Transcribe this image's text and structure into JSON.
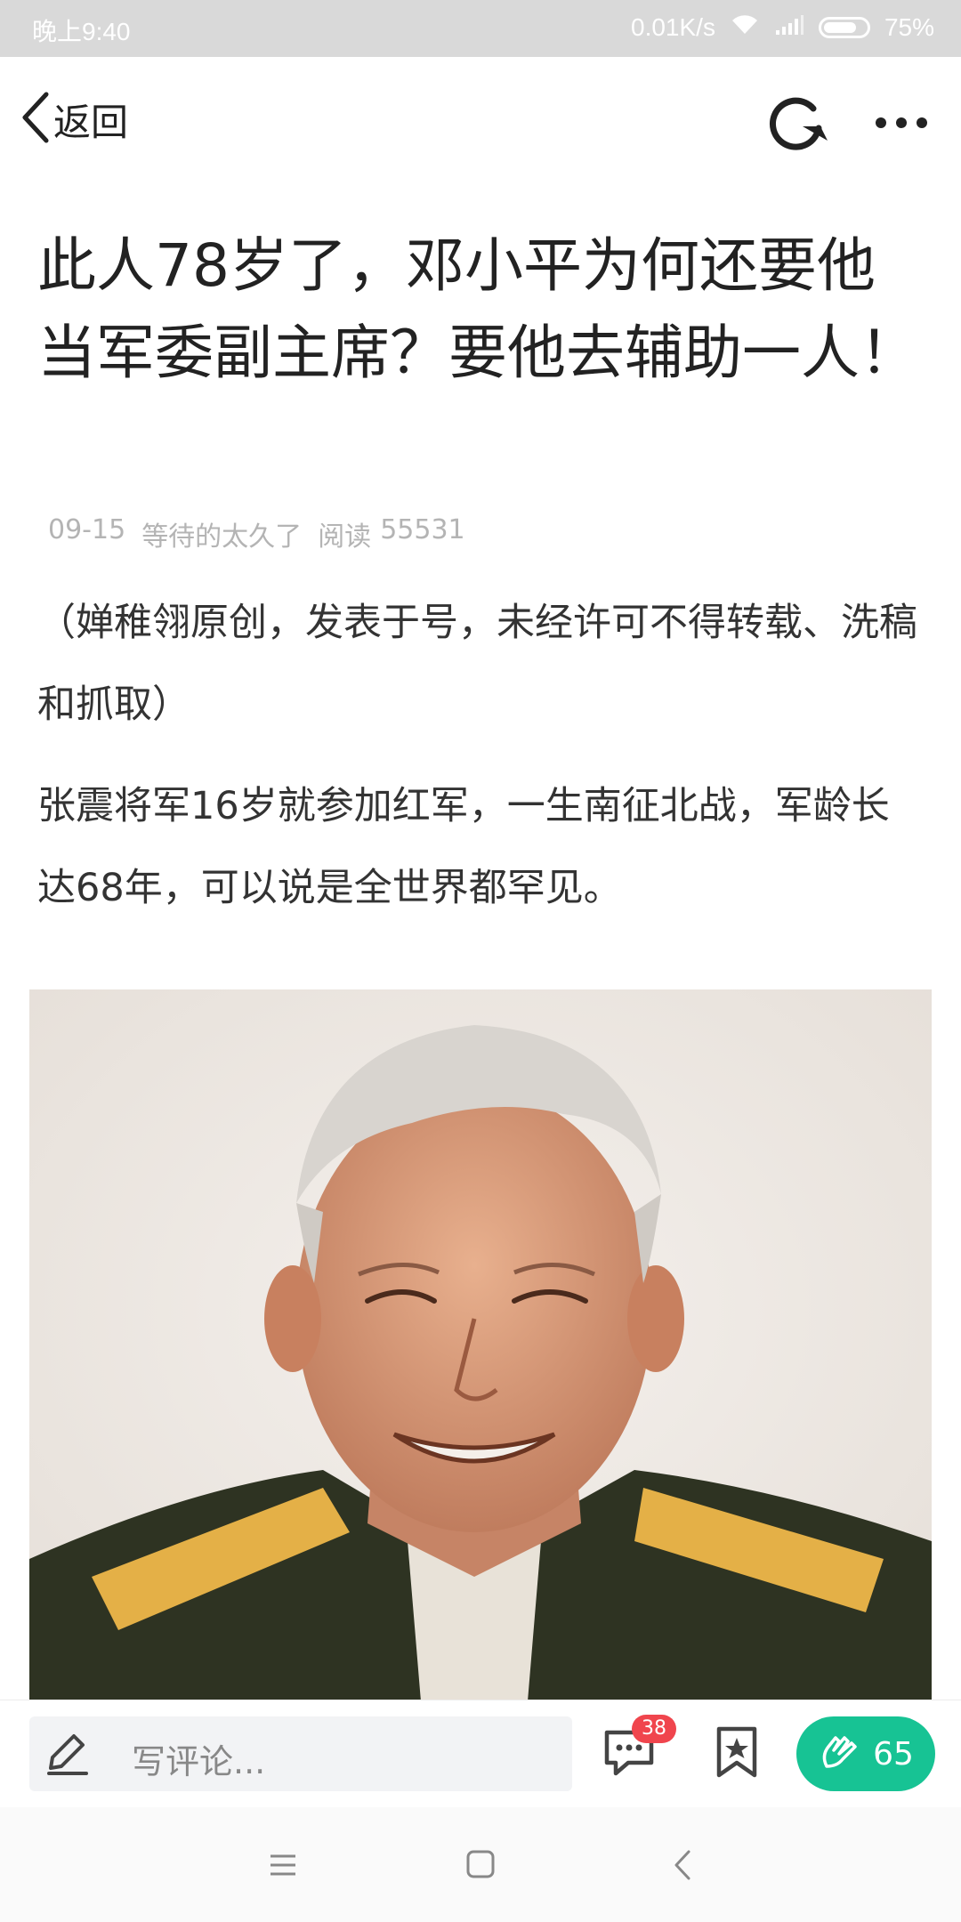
{
  "status_bar": {
    "time": "晚上9:40",
    "network_speed": "0.01K/s",
    "battery": "75%",
    "battery_level": 0.75
  },
  "nav": {
    "back_label": "返回",
    "refresh_icon": "refresh-icon",
    "more_icon": "more-icon"
  },
  "article": {
    "title": "此人78岁了，邓小平为何还要他当军委副主席？要他去辅助一人！",
    "date": "09-15",
    "author": "等待的太久了",
    "reads_label": "阅读",
    "reads_count": "55531",
    "paragraphs": [
      "（婵稚翎原创，发表于号，未经许可不得转载、洗稿和抓取）",
      "张震将军16岁就参加红军，一生南征北战，军龄长达68年，可以说是全世界都罕见。"
    ]
  },
  "action_bar": {
    "comment_placeholder": "写评论...",
    "comment_count": "38",
    "like_count": "65",
    "colors": {
      "like_bg": "#17c394",
      "badge_bg": "#f0454d"
    }
  },
  "system_nav": {
    "icons": [
      "menu-icon",
      "home-icon",
      "back-icon"
    ]
  }
}
